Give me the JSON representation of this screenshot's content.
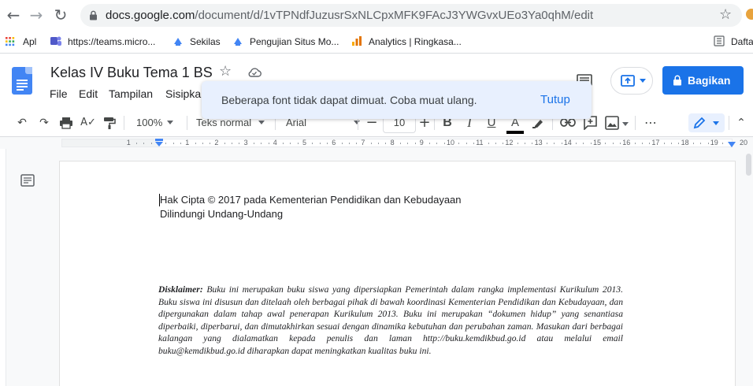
{
  "browser": {
    "url_host": "docs.google.com",
    "url_path": "/document/d/1vTPNdfJuzusrSxNLCpxMFK9FAcJ3YWGvxUEo3Ya0qhM/edit",
    "bookmarks": [
      "Apl",
      "https://teams.micro...",
      "Sekilas",
      "Pengujian Situs Mo...",
      "Analytics | Ringkasa...",
      "Dafta"
    ]
  },
  "doc": {
    "title": "Kelas IV Buku Tema 1 BS",
    "menu": [
      "File",
      "Edit",
      "Tampilan",
      "Sisipka"
    ],
    "share_label": "Bagikan"
  },
  "toast": {
    "message": "Beberapa font tidak dapat dimuat. Coba muat ulang.",
    "action": "Tutup"
  },
  "toolbar": {
    "zoom": "100%",
    "style": "Teks normal",
    "font": "Arial",
    "font_size": "10"
  },
  "ruler": {
    "numbers": [
      "1",
      "1",
      "2",
      "3",
      "4",
      "5",
      "6",
      "7",
      "8",
      "9",
      "10",
      "11",
      "12",
      "13",
      "14",
      "15",
      "16",
      "17",
      "18",
      "19",
      "20",
      "21"
    ]
  },
  "content": {
    "line1": "Hak Cipta © 2017 pada Kementerian Pendidikan dan Kebudayaan",
    "line2": "Dilindungi Undang-Undang",
    "disclaimer_label": "Disklaimer:",
    "disclaimer_text": " Buku ini merupakan buku siswa yang dipersiapkan Pemerintah dalam rangka implementasi Kurikulum 2013. Buku siswa ini disusun dan ditelaah oleh berbagai pihak di bawah koordinasi Kementerian Pendidikan dan Kebudayaan, dan dipergunakan dalam tahap awal penerapan Kurikulum 2013. Buku ini merupakan “dokumen hidup” yang senantiasa diperbaiki, diperbarui, dan dimutakhirkan sesuai dengan dinamika kebutuhan dan perubahan zaman. Masukan dari berbagai kalangan yang dialamatkan kepada penulis dan laman http://buku.kemdikbud.go.id atau melalui email buku@kemdikbud.go.id diharapkan dapat meningkatkan kualitas buku ini."
  },
  "colors": {
    "accent": "#1a73e8",
    "docs_blue": "#4285f4",
    "toast_bg": "#e8f0fe"
  }
}
